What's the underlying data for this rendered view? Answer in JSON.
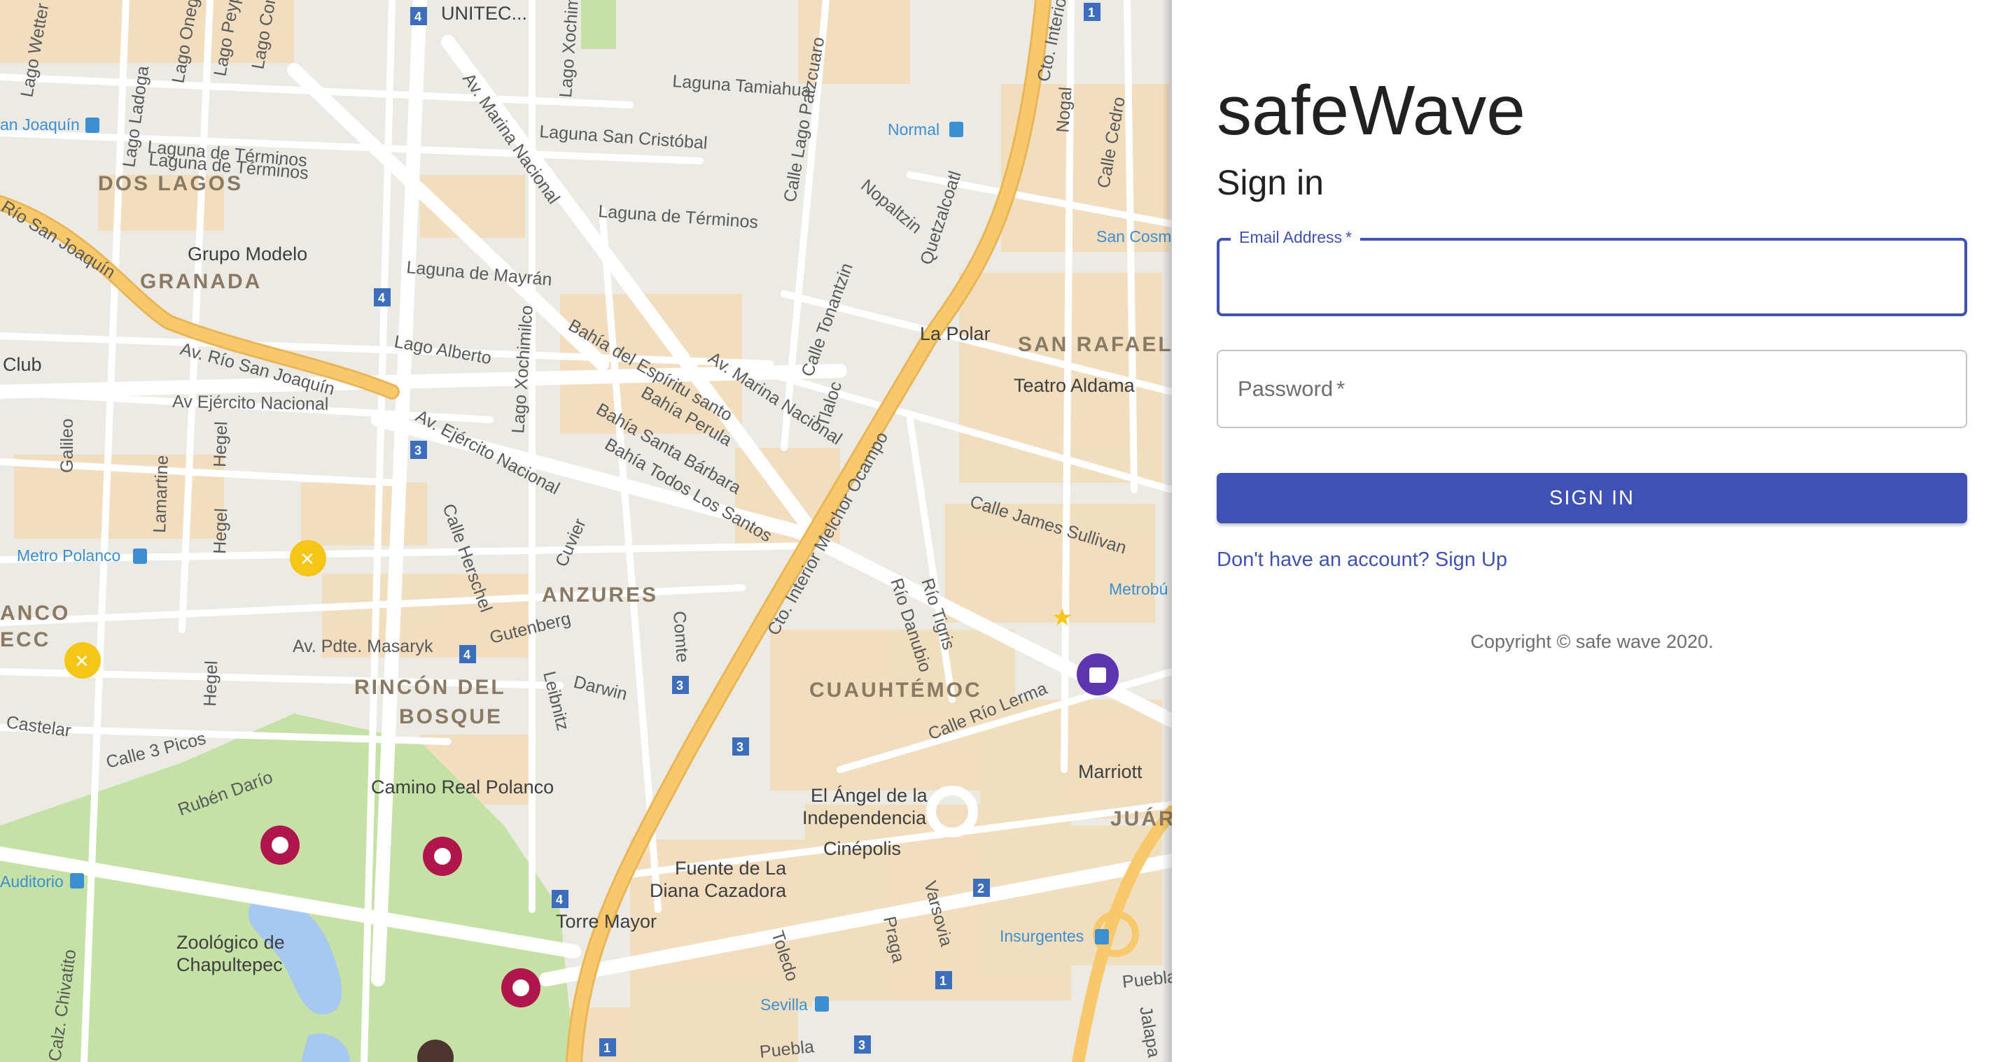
{
  "map": {
    "districts": [
      "DOS LAGOS",
      "GRANADA",
      "SAN RAFAEL",
      "ANZURES",
      "RINCÓN DEL",
      "BOSQUE",
      "CUAUHTÉMOC",
      "ANCO",
      "ECC",
      "JUÁR"
    ],
    "streets": [
      "Lago Wetter",
      "Lago Onega",
      "Lago Peypus",
      "Lago Como",
      "Laguna Tamiahua",
      "Laguna San Cristóbal",
      "Laguna de Términos",
      "Laguna de Términos",
      "Laguna de Mayrán",
      "Río San Joaquín",
      "Av. Río San Joaquín",
      "Lago Alberto",
      "Av Ejército Nacional",
      "Av. Ejército Nacional",
      "Av. Marina Nacional",
      "Av. Marina Nacional",
      "Bahía del Espíritu santo",
      "Bahía Perula",
      "Bahía Santa Bárbara",
      "Bahía Todos Los Santos",
      "Calle Lago Patzcuaro",
      "Nopaltzin",
      "Quetzalcoatl",
      "Calle Tonantzin",
      "Tlaloc",
      "Cto. Interior Melchor Ocampo",
      "Cto. Interior",
      "Calle James Sullivan",
      "Río Danubio",
      "Río Tigris",
      "Calle Río Lerma",
      "Gutenberg",
      "Av. Pdte. Masaryk",
      "Darwin",
      "Leibnitz",
      "Comte",
      "Cuvier",
      "Calle Herschel",
      "Lago Xochimilco",
      "Lago Xochimilco",
      "Galileo",
      "Lamartine",
      "Hegel",
      "Hegel",
      "Hegel",
      "Castelar",
      "Calle 3 Picos",
      "Rubén Darío",
      "Varsovia",
      "Praga",
      "Toledo",
      "Nogal",
      "Calle Cedro",
      "Puebla",
      "Puebla",
      "Jalapa",
      "Lago Ladoga",
      "Laguna de Términos",
      "Calz. Chivatito"
    ],
    "pois": [
      "UNITEC...",
      "Grupo Modelo",
      "Club",
      "La Polar",
      "Teatro Aldama",
      "Camino Real Polanco",
      "El Ángel de la",
      "Independencia",
      "Cinépolis",
      "Fuente de La",
      "Diana Cazadora",
      "Torre Mayor",
      "Marriott",
      "Zoológico de",
      "Chapultepec"
    ],
    "metro_stations": [
      "an Joaquín",
      "Normal",
      "San Cosm",
      "Metro Polanco",
      "Metrobú",
      "Auditorio",
      "Insurgentes",
      "Sevilla"
    ],
    "route_shields": [
      "4",
      "1",
      "4",
      "3",
      "4",
      "3",
      "3",
      "2",
      "4",
      "1",
      "3",
      "1"
    ]
  },
  "auth": {
    "brand": "safeWave",
    "title": "Sign in",
    "email_label": "Email Address",
    "password_label": "Password",
    "required_mark": "*",
    "email_value": "",
    "password_value": "",
    "submit_label": "SIGN IN",
    "signup_text": "Don't have an account? Sign Up",
    "copyright": "Copyright © safe wave 2020."
  },
  "colors": {
    "primary": "#3f51b5",
    "text": "#212121",
    "muted": "#6e6e6e",
    "map_background": "#eceae5",
    "park": "#c5e1a5",
    "water": "#a7c8f0",
    "highway": "#f7c96c",
    "block": "#f3dcb8"
  }
}
